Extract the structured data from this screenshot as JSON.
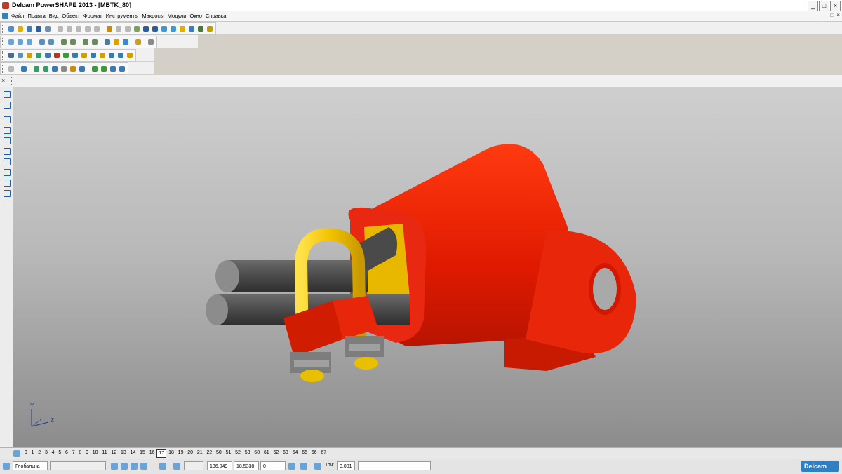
{
  "window": {
    "title": "Delcam PowerSHAPE 2013 - [MBTK_80]",
    "controls": [
      "_",
      "□",
      "×"
    ]
  },
  "menu": {
    "items": [
      "Файл",
      "Правка",
      "Вид",
      "Объект",
      "Формат",
      "Инструменты",
      "Макросы",
      "Модули",
      "Окно",
      "Справка"
    ],
    "mdi_controls": [
      "_",
      "□",
      "×"
    ]
  },
  "viewport": {
    "axes": {
      "y": "Y",
      "z": "Z"
    },
    "colors": {
      "part": "#e02010",
      "bolt": "#f2c200",
      "cable": "#545454",
      "nut": "#8c8c8c"
    }
  },
  "levels": {
    "items": [
      "0",
      "1",
      "2",
      "3",
      "4",
      "5",
      "6",
      "7",
      "8",
      "9",
      "10",
      "11",
      "12",
      "13",
      "14",
      "15",
      "16",
      "17",
      "18",
      "19",
      "20",
      "21",
      "22",
      "50",
      "51",
      "52",
      "53",
      "60",
      "61",
      "62",
      "63",
      "64",
      "65",
      "66",
      "67"
    ],
    "selected": "17"
  },
  "status": {
    "workplane": "Глобальна",
    "x": "136.049",
    "y": "18.5338",
    "z": "0",
    "tolerance_label": "Точ:",
    "tolerance": "0.001",
    "brand": "Delcam"
  }
}
